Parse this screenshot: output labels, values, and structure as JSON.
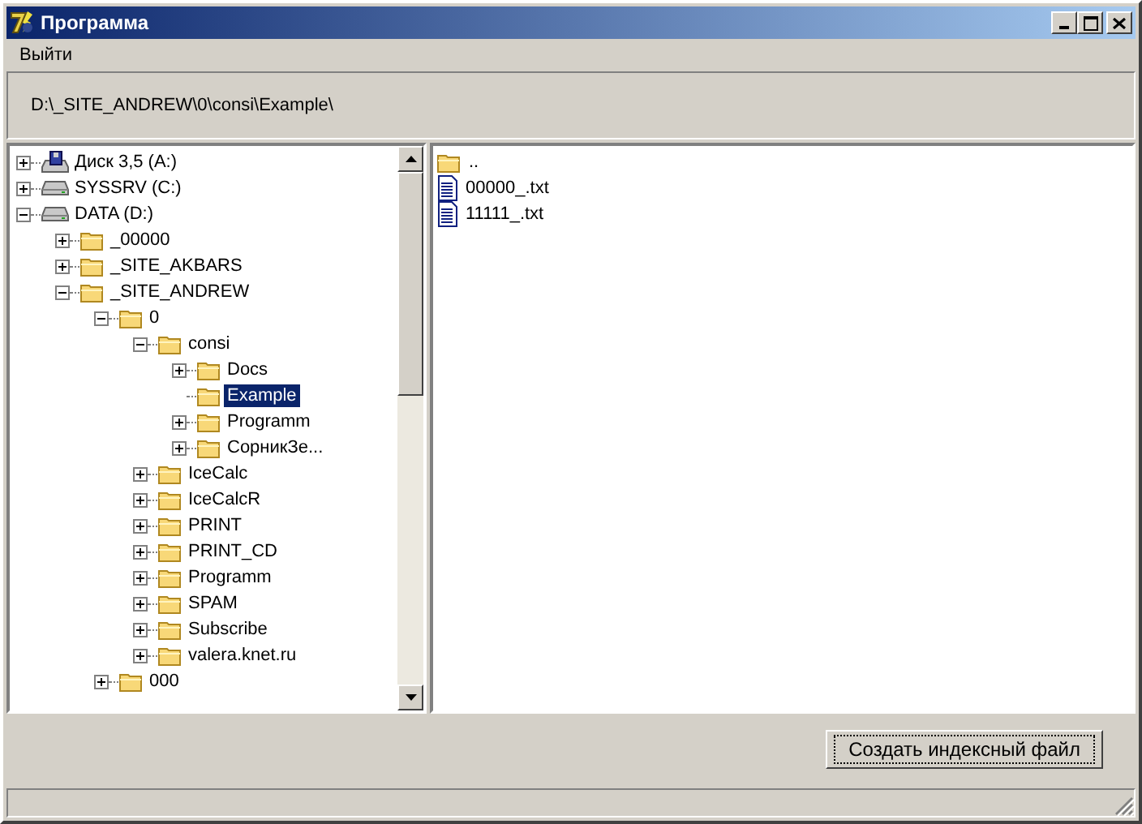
{
  "window": {
    "title": "Программа"
  },
  "menu": [
    "Выйти"
  ],
  "path": "D:\\_SITE_ANDREW\\0\\consi\\Example\\",
  "tree": [
    {
      "label": "Диск 3,5 (A:)",
      "kind": "floppy",
      "expanded": false,
      "selected": false
    },
    {
      "label": "SYSSRV (C:)",
      "kind": "drive",
      "expanded": false,
      "selected": false
    },
    {
      "label": "DATA (D:)",
      "kind": "drive",
      "expanded": true,
      "selected": false,
      "children": [
        {
          "label": "_00000",
          "kind": "folder",
          "expanded": false,
          "selected": false
        },
        {
          "label": "_SITE_AKBARS",
          "kind": "folder",
          "expanded": false,
          "selected": false
        },
        {
          "label": "_SITE_ANDREW",
          "kind": "folder",
          "expanded": true,
          "selected": false,
          "children": [
            {
              "label": "0",
              "kind": "folder",
              "expanded": true,
              "selected": false,
              "children": [
                {
                  "label": "consi",
                  "kind": "folder",
                  "expanded": true,
                  "selected": false,
                  "children": [
                    {
                      "label": "Docs",
                      "kind": "folder",
                      "expanded": false,
                      "selected": false
                    },
                    {
                      "label": "Example",
                      "kind": "folder",
                      "selected": true
                    },
                    {
                      "label": "Programm",
                      "kind": "folder",
                      "expanded": false,
                      "selected": false
                    },
                    {
                      "label": "СорникЗе...",
                      "kind": "folder",
                      "expanded": false,
                      "selected": false
                    }
                  ]
                },
                {
                  "label": "IceCalc",
                  "kind": "folder",
                  "expanded": false,
                  "selected": false
                },
                {
                  "label": "IceCalcR",
                  "kind": "folder",
                  "expanded": false,
                  "selected": false
                },
                {
                  "label": "PRINT",
                  "kind": "folder",
                  "expanded": false,
                  "selected": false
                },
                {
                  "label": "PRINT_CD",
                  "kind": "folder",
                  "expanded": false,
                  "selected": false
                },
                {
                  "label": "Programm",
                  "kind": "folder",
                  "expanded": false,
                  "selected": false
                },
                {
                  "label": "SPAM",
                  "kind": "folder",
                  "expanded": false,
                  "selected": false
                },
                {
                  "label": "Subscribe",
                  "kind": "folder",
                  "expanded": false,
                  "selected": false
                },
                {
                  "label": "valera.knet.ru",
                  "kind": "folder",
                  "expanded": false,
                  "selected": false
                }
              ]
            },
            {
              "label": "000",
              "kind": "folder",
              "expanded": false,
              "selected": false
            }
          ]
        }
      ]
    }
  ],
  "files": [
    {
      "label": "..",
      "kind": "folder"
    },
    {
      "label": "00000_.txt",
      "kind": "file"
    },
    {
      "label": "11111_.txt",
      "kind": "file"
    }
  ],
  "buttons": [
    "Создать индексный файл"
  ]
}
